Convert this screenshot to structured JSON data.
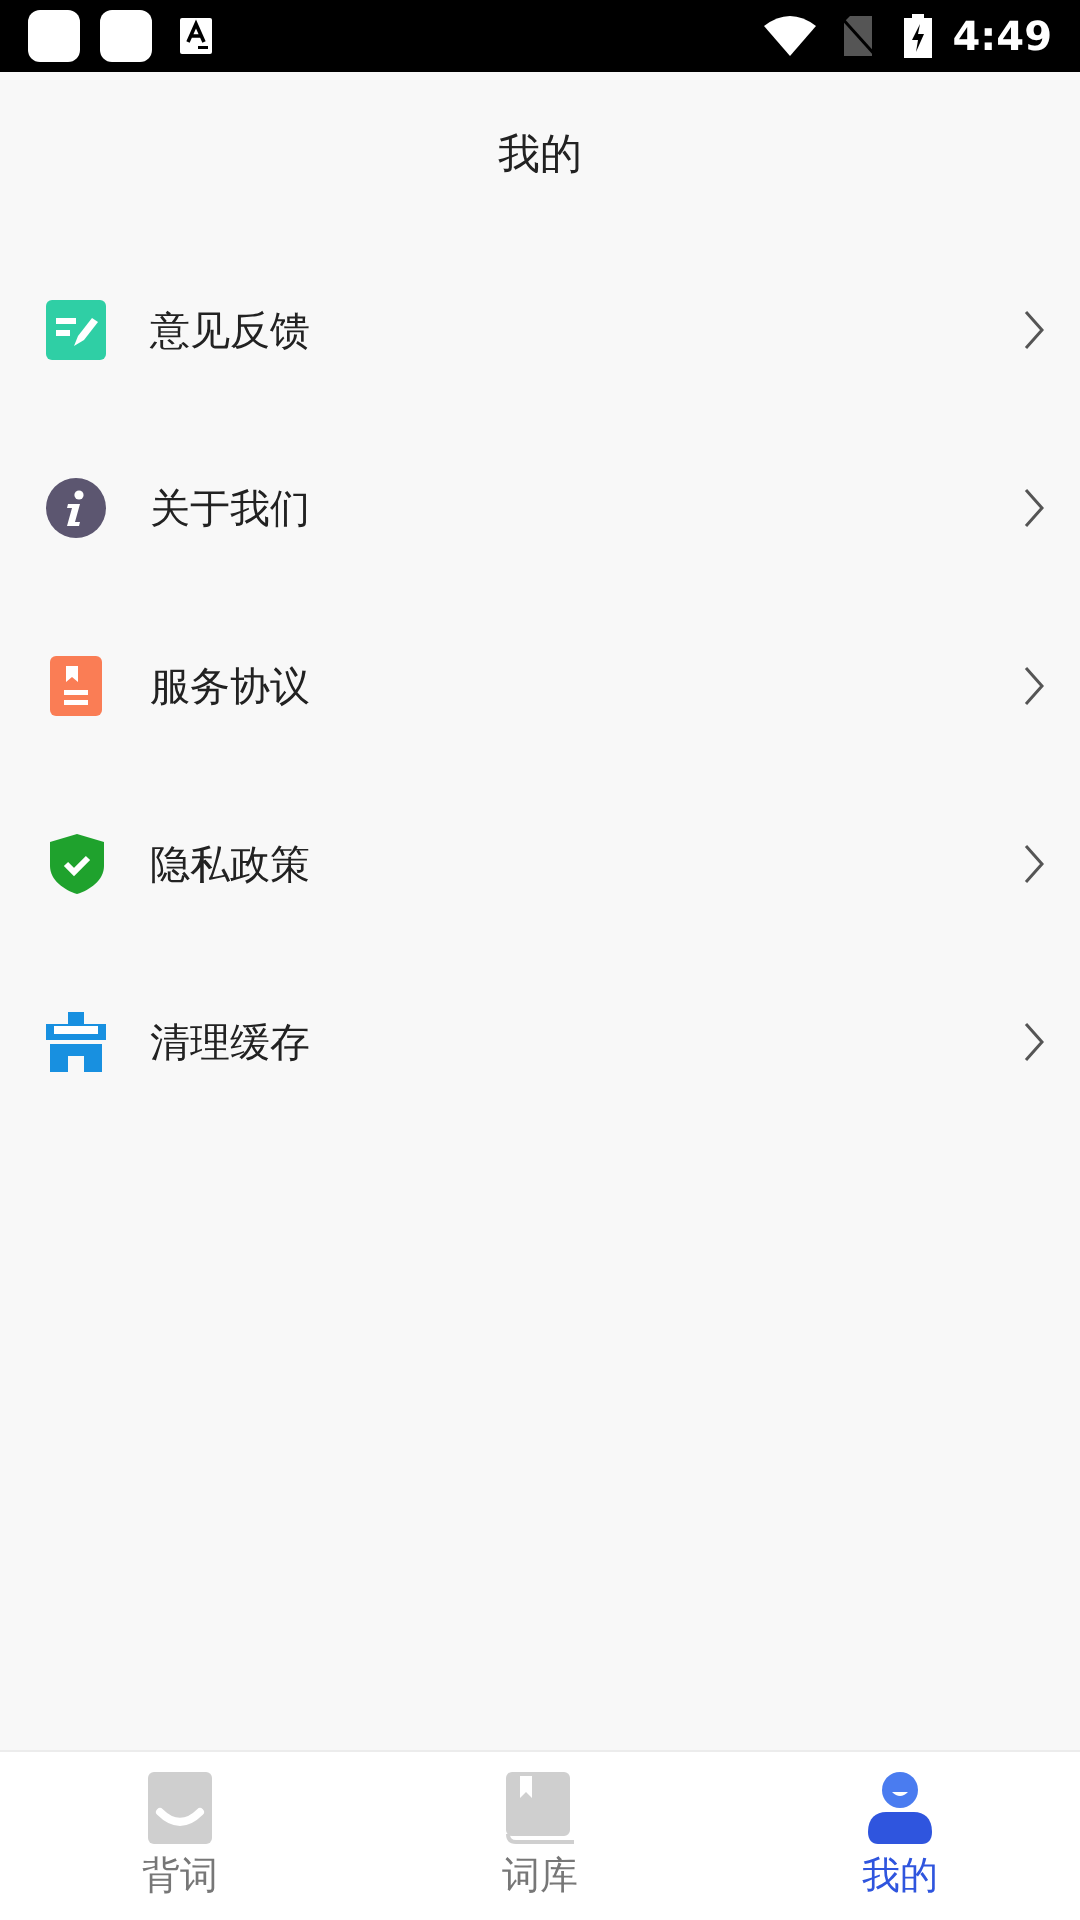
{
  "status_bar": {
    "time": "4:49"
  },
  "header": {
    "title": "我的"
  },
  "menu": [
    {
      "kind": "feedback",
      "label": "意见反馈"
    },
    {
      "kind": "about",
      "label": "关于我们"
    },
    {
      "kind": "agreement",
      "label": "服务协议"
    },
    {
      "kind": "privacy",
      "label": "隐私政策"
    },
    {
      "kind": "cache",
      "label": "清理缓存"
    }
  ],
  "tabs": [
    {
      "kind": "words",
      "label": "背词",
      "selected": false
    },
    {
      "kind": "library",
      "label": "词库",
      "selected": false
    },
    {
      "kind": "me",
      "label": "我的",
      "selected": true
    }
  ]
}
